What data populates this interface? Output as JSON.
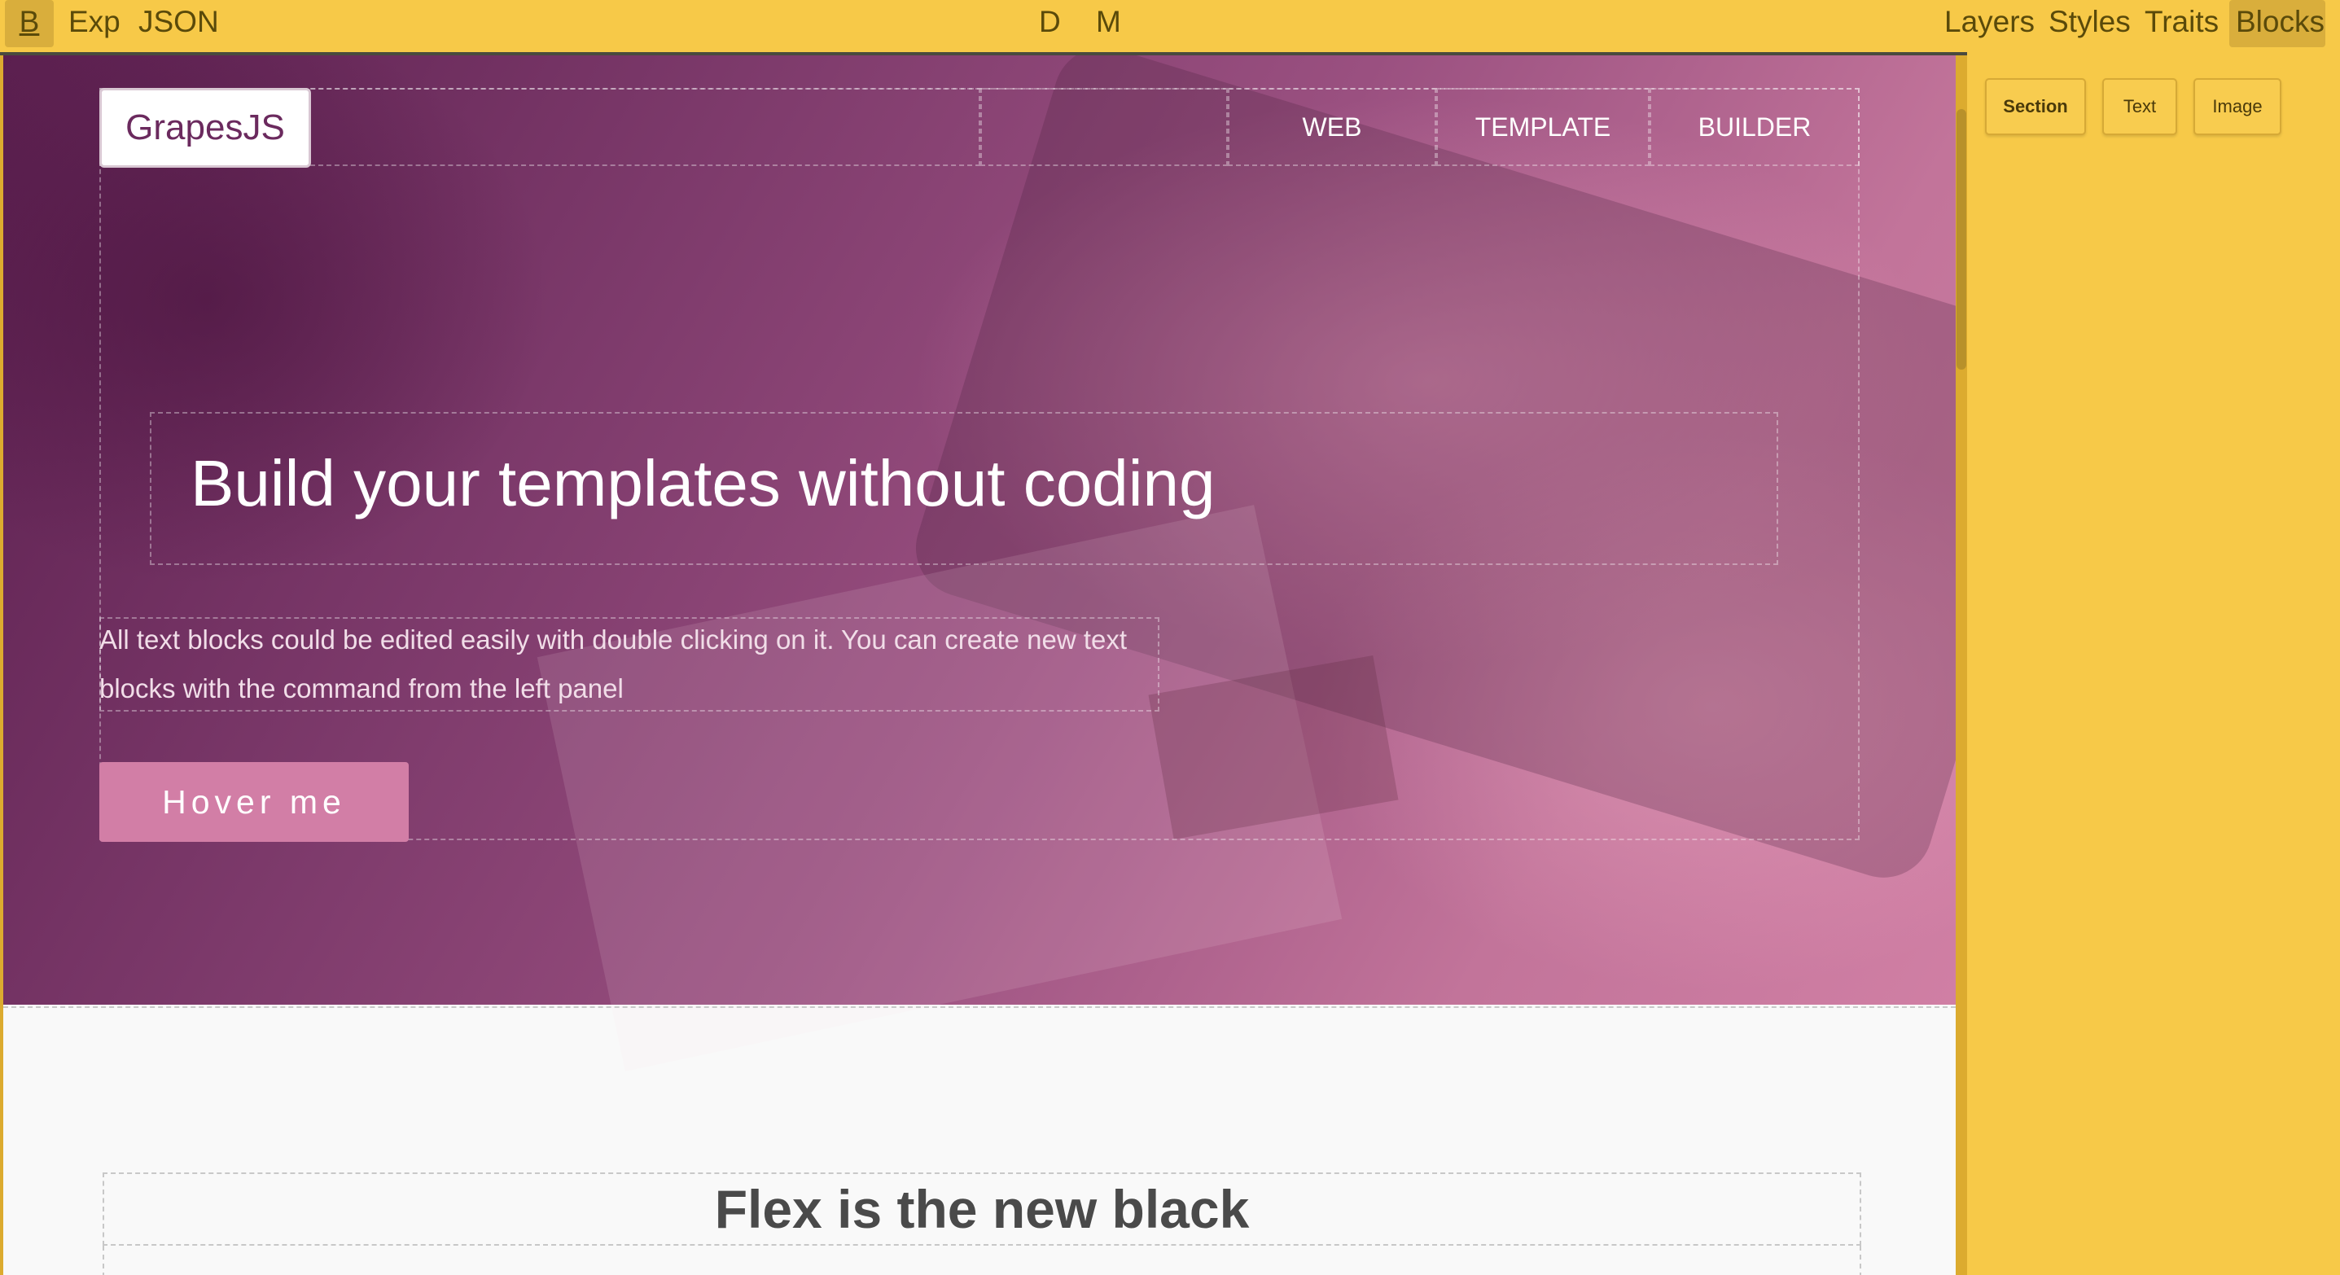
{
  "toolbar": {
    "left": [
      "B",
      "Exp",
      "JSON"
    ],
    "center": [
      "D",
      "M"
    ],
    "right": [
      "Layers",
      "Styles",
      "Traits",
      "Blocks"
    ],
    "active": "Blocks"
  },
  "hero": {
    "logo": "GrapesJS",
    "nav": [
      "WEB",
      "TEMPLATE",
      "BUILDER"
    ],
    "title": "Build your templates without coding",
    "text": "All text blocks could be edited easily with double clicking on it. You can create new text blocks with the command from the left panel",
    "button": "Hover me"
  },
  "section2": {
    "title": "Flex is the new black"
  },
  "blocks": [
    "Section",
    "Text",
    "Image"
  ]
}
